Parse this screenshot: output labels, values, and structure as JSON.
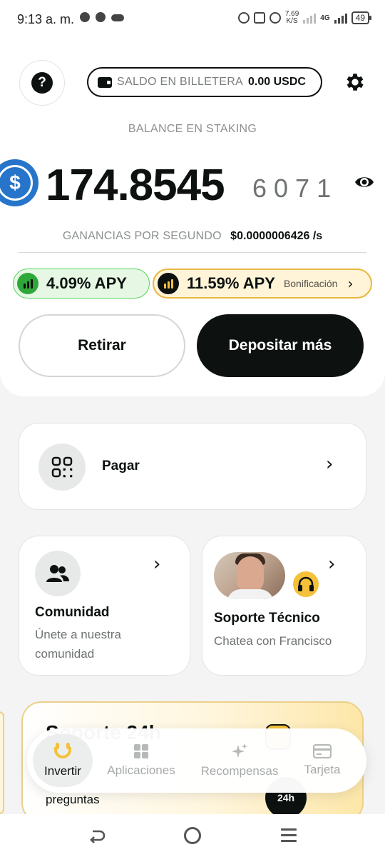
{
  "status_bar": {
    "time": "9:13 a. m.",
    "net_speed_value": "7.69",
    "net_speed_unit": "K/S",
    "network_type": "4G",
    "battery": "49"
  },
  "header": {
    "help_symbol": "?",
    "wallet_label": "SALDO EN BILLETERA",
    "wallet_value": "0.00 USDC"
  },
  "staking": {
    "label": "BALANCE EN STAKING",
    "currency_symbol": "$",
    "balance_main": "174.8545",
    "balance_decimals": "6071",
    "earnings_label": "GANANCIAS POR SEGUNDO",
    "earnings_value": "$0.0000006426 /s"
  },
  "apy": {
    "base": "4.09% APY",
    "bonus": "11.59% APY",
    "bonus_tag": "Bonificación"
  },
  "actions": {
    "withdraw": "Retirar",
    "deposit": "Depositar más"
  },
  "cards": {
    "pay": {
      "label": "Pagar"
    },
    "community": {
      "title": "Comunidad",
      "subtitle_line1": "Únete a nuestra",
      "subtitle_line2": "comunidad"
    },
    "support": {
      "title": "Soporte Técnico",
      "subtitle": "Chatea con Francisco"
    }
  },
  "promo": {
    "title": "Soporte 24h",
    "subtitle": "preguntas",
    "badge": "24h"
  },
  "bottom_nav": {
    "items": [
      "Invertir",
      "Aplicaciones",
      "Recompensas",
      "Tarjeta"
    ],
    "active": "Invertir"
  },
  "colors": {
    "primary": "#0d1210",
    "usdc_blue": "#2775ca",
    "apy_green": "#2fa83a",
    "gold": "#f5c13a"
  }
}
